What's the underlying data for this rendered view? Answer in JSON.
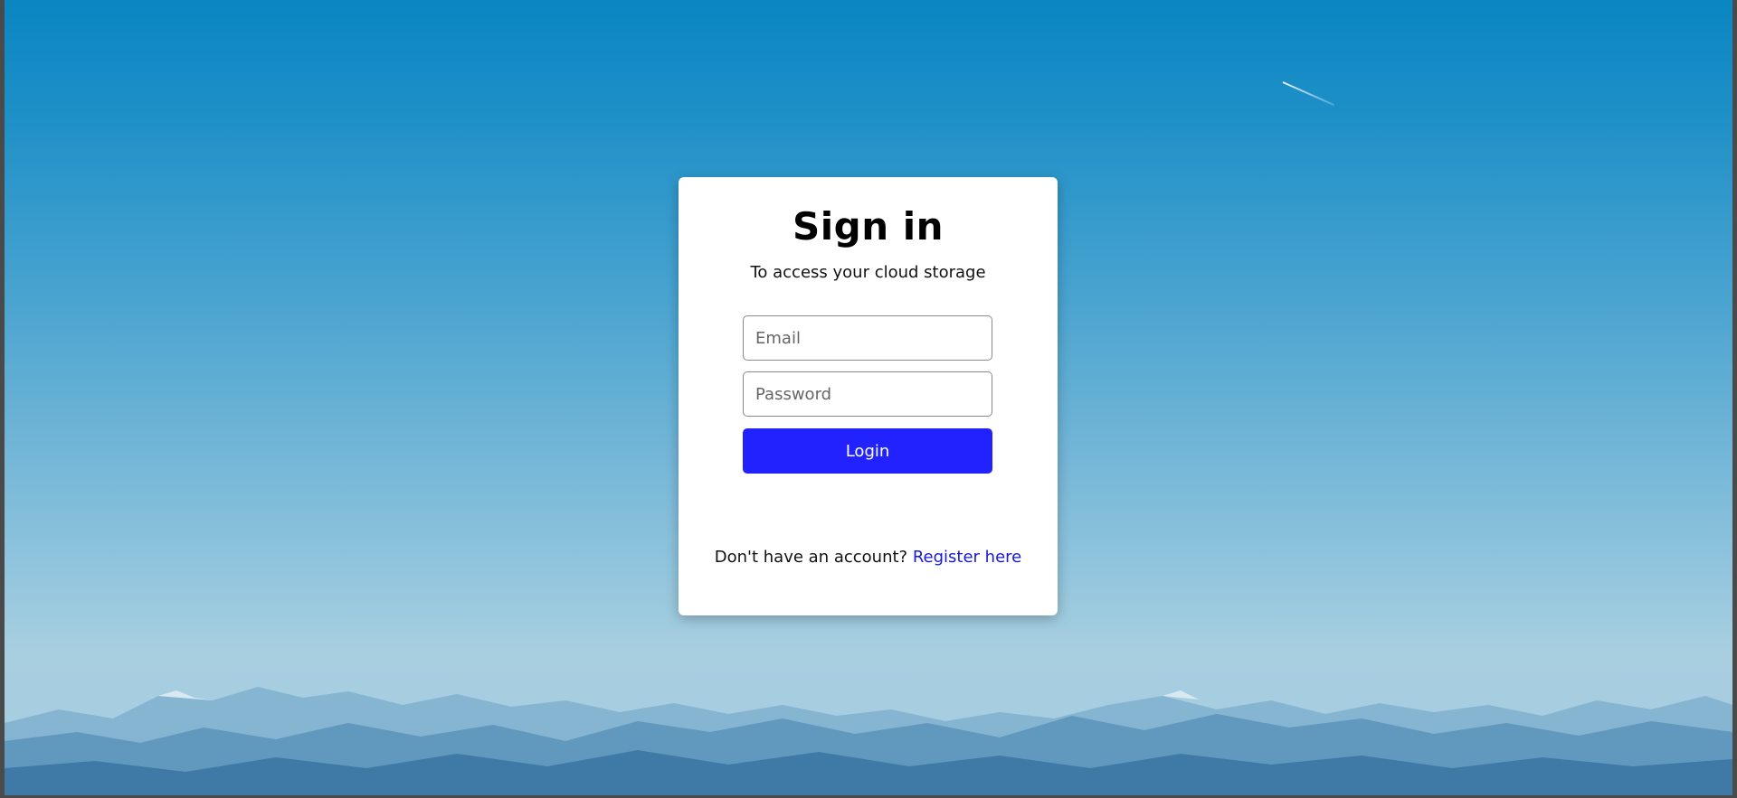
{
  "signin": {
    "title": "Sign in",
    "subtitle": "To access your cloud storage",
    "email_placeholder": "Email",
    "password_placeholder": "Password",
    "login_label": "Login",
    "register_prompt": "Don't have an account?",
    "register_link": "Register here"
  },
  "colors": {
    "accent": "#2222ff",
    "link": "#1a1ad6",
    "sky_top": "#0a86c2",
    "sky_bottom": "#a8cfe0"
  }
}
